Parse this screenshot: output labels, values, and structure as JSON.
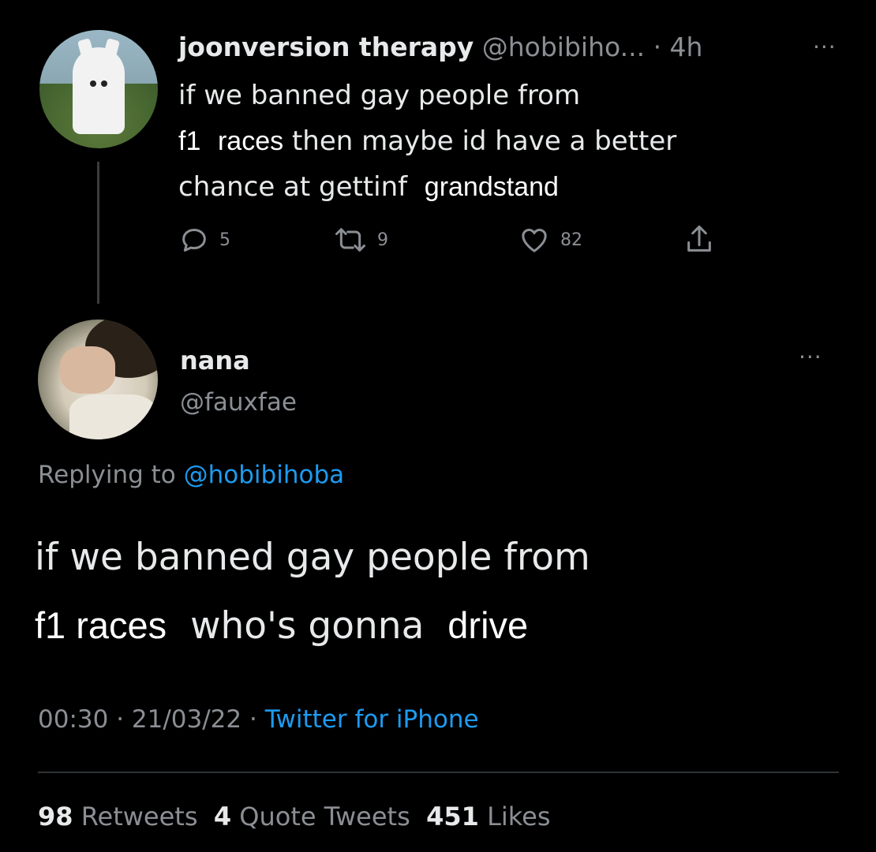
{
  "parent": {
    "name": "joonversion therapy",
    "handle_time": "@hobibiho... · 4h",
    "text_1": "if we banned gay people from",
    "text_2a": "f1",
    "text_2b": "races",
    "text_2c": "then maybe id have a better",
    "text_3a": "chance at gettinf",
    "text_3b": "grandstand",
    "reply_count": "5",
    "retweet_count": "9",
    "like_count": "82",
    "more": "···"
  },
  "reply": {
    "name": "nana",
    "handle": "@fauxfae",
    "replying_prefix": "Replying to",
    "replying_handle": "@hobibihoba",
    "text_1": "if we banned gay people from",
    "text_2a": "f1 races",
    "text_2b": "who's gonna",
    "text_2c": "drive",
    "time_date": "00:30 · 21/03/22 ·",
    "source": "Twitter for iPhone",
    "more": "···"
  },
  "stats": {
    "retweets_num": "98",
    "retweets_label": "Retweets",
    "quotes_num": "4",
    "quotes_label": "Quote Tweets",
    "likes_num": "451",
    "likes_label": "Likes"
  },
  "colors": {
    "background": "#000000",
    "text": "#e7e9ea",
    "muted": "#8b8f94",
    "link": "#1d9bf0"
  },
  "icons": [
    "reply-icon",
    "retweet-icon",
    "like-icon",
    "share-icon",
    "more-icon"
  ]
}
